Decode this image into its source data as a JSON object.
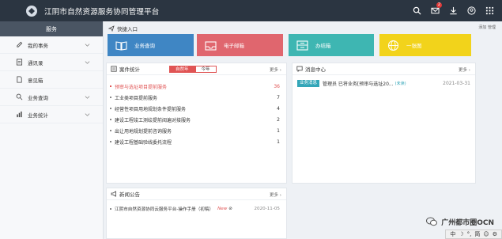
{
  "app": {
    "title": "江阴市自然资源服务协同管理平台"
  },
  "header": {
    "notification_count": "2"
  },
  "sidebar": {
    "title": "服务",
    "items": [
      {
        "label": "我的事务"
      },
      {
        "label": "通讯录"
      },
      {
        "label": "意见箱"
      },
      {
        "label": "业务查询"
      },
      {
        "label": "业务统计"
      }
    ]
  },
  "quick": {
    "title": "快捷入口",
    "manage": "添加 管理",
    "tiles": [
      {
        "label": "业务查询",
        "color": "#3f86c4"
      },
      {
        "label": "电子邮箱",
        "color": "#e0666e"
      },
      {
        "label": "办结箱",
        "color": "#3eb6b2"
      },
      {
        "label": "一张图",
        "color": "#f2d31b"
      }
    ]
  },
  "stats": {
    "title": "案件统计",
    "more": "更多",
    "tab_active": "自然年",
    "tab_idle": "今年",
    "rows": [
      {
        "label": "预审与选址项目提前服务",
        "count": "36"
      },
      {
        "label": "工业类项目提前服务",
        "count": "7"
      },
      {
        "label": "经营性项目用地规划条件提前服务",
        "count": "4"
      },
      {
        "label": "建设工程竣工测绘提前阅遍对接服务",
        "count": "2"
      },
      {
        "label": "出让用地规划提前咨询服务",
        "count": "1"
      },
      {
        "label": "建设工程基础验线委托流程",
        "count": "1"
      }
    ]
  },
  "messages": {
    "title": "消息中心",
    "more": "更多",
    "items": [
      {
        "tag": "业务消息",
        "text": "管理员 已将业务[预审与选址20...",
        "status": "(未读)",
        "date": "2021-03-31"
      }
    ]
  },
  "news": {
    "title": "新闻公告",
    "more": "更多",
    "items": [
      {
        "text": "江阴市自然资源协同云服务平台-操作手册（初稿）",
        "flag": "New",
        "date": "2020-11-05"
      }
    ]
  },
  "watermark": {
    "text": "广州都市圈OCN"
  },
  "ime": {
    "items": [
      "中",
      "☽",
      "°,",
      "简",
      "☺",
      "⚙"
    ]
  },
  "colors": {
    "topbar": "#2b3541",
    "accent_red": "#e05454"
  }
}
